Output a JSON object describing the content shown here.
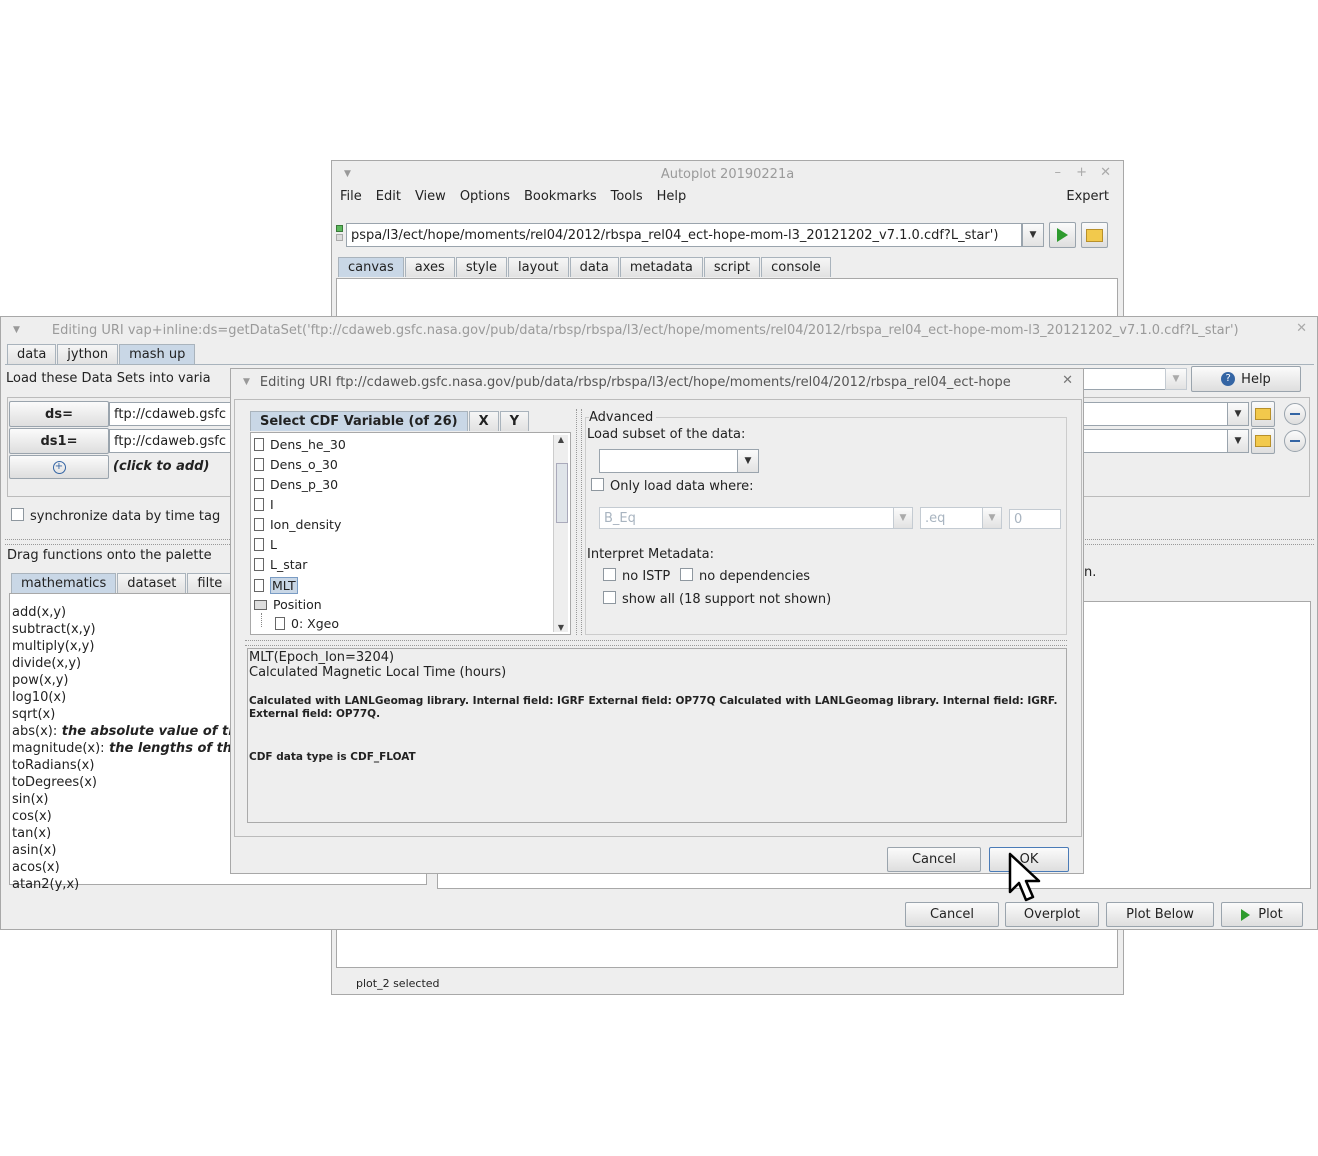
{
  "autoplot": {
    "title": "Autoplot 20190221a",
    "menu": [
      "File",
      "Edit",
      "View",
      "Options",
      "Bookmarks",
      "Tools",
      "Help"
    ],
    "expert": "Expert",
    "uri": "pspa/l3/ect/hope/moments/rel04/2012/rbspa_rel04_ect-hope-mom-l3_20121202_v7.1.0.cdf?L_star')",
    "tabs": [
      "canvas",
      "axes",
      "style",
      "layout",
      "data",
      "metadata",
      "script",
      "console"
    ],
    "status": "plot_2 selected"
  },
  "editor": {
    "title": "Editing URI vap+inline:ds=getDataSet('ftp://cdaweb.gsfc.nasa.gov/pub/data/rbsp/rbspa/l3/ect/hope/moments/rel04/2012/rbspa_rel04_ect-hope-mom-l3_20121202_v7.1.0.cdf?L_star')",
    "tabs": [
      "data",
      "jython",
      "mash up"
    ],
    "load_label": "Load these Data Sets into varia",
    "help": "Help",
    "ds_label": "ds=",
    "ds1_label": "ds1=",
    "ds_value": "ftp://cdaweb.gsfc",
    "ds1_value": "ftp://cdaweb.gsfc",
    "click_to_add": "(click to add)",
    "sync_label": "synchronize data by time tag",
    "drag_label": "Drag functions onto the palette",
    "right_text_fragment": "n.",
    "fn_tabs": [
      "mathematics",
      "dataset",
      "filte"
    ],
    "functions": [
      {
        "name": "add(x,y)",
        "desc": ""
      },
      {
        "name": "subtract(x,y)",
        "desc": ""
      },
      {
        "name": "multiply(x,y)",
        "desc": ""
      },
      {
        "name": "divide(x,y)",
        "desc": ""
      },
      {
        "name": "pow(x,y)",
        "desc": ""
      },
      {
        "name": "log10(x)",
        "desc": ""
      },
      {
        "name": "sqrt(x)",
        "desc": ""
      },
      {
        "name": "abs(x):",
        "desc": " the absolute value of the"
      },
      {
        "name": "magnitude(x):",
        "desc": " the lengths of the"
      },
      {
        "name": "toRadians(x)",
        "desc": ""
      },
      {
        "name": "toDegrees(x)",
        "desc": ""
      },
      {
        "name": "sin(x)",
        "desc": ""
      },
      {
        "name": "cos(x)",
        "desc": ""
      },
      {
        "name": "tan(x)",
        "desc": ""
      },
      {
        "name": "asin(x)",
        "desc": ""
      },
      {
        "name": "acos(x)",
        "desc": ""
      },
      {
        "name": "atan2(y,x)",
        "desc": ""
      }
    ],
    "cancel": "Cancel",
    "overplot": "Overplot",
    "plot_below": "Plot Below",
    "plot": "Plot"
  },
  "cdf": {
    "title": "Editing URI ftp://cdaweb.gsfc.nasa.gov/pub/data/rbsp/rbspa/l3/ect/hope/moments/rel04/2012/rbspa_rel04_ect-hope",
    "tabs": [
      "Select CDF Variable (of 26)",
      "X",
      "Y"
    ],
    "variables": [
      "Dens_he_30",
      "Dens_o_30",
      "Dens_p_30",
      "I",
      "Ion_density",
      "L",
      "L_star",
      "MLT"
    ],
    "selected": "MLT",
    "folder": "Position",
    "child": "0: Xgeo",
    "advanced": "Advanced",
    "subset_label": "Load subset of the data:",
    "only_load": "Only load data where:",
    "where_var": "B_Eq",
    "where_op": ".eq",
    "where_val": "0",
    "interpret": "Interpret Metadata:",
    "no_istp": "no ISTP",
    "no_deps": "no dependencies",
    "show_all": "show all (18 support not shown)",
    "desc_line1": "MLT(Epoch_Ion=3204)",
    "desc_line2": "Calculated Magnetic Local Time (hours)",
    "desc_line3": "Calculated with LANLGeomag library. Internal field: IGRF External field: OP77Q Calculated with LANLGeomag library. Internal field: IGRF. External field: OP77Q.",
    "desc_line4": "CDF data type is CDF_FLOAT",
    "cancel": "Cancel",
    "ok": "OK"
  }
}
